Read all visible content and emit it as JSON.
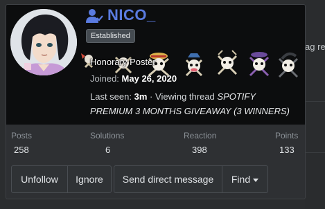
{
  "background": {
    "partial_text": "ag re"
  },
  "profile": {
    "username": "NICO_",
    "badge": "Established",
    "title": "Honorary Poster",
    "joined_label": "Joined:",
    "joined_date": "May 26, 2020",
    "last_seen_label": "Last seen:",
    "last_seen_time": "3m",
    "activity": "Viewing thread",
    "thread_title": "SPOTIFY PREMIUM 3 MONTHS GIVEAWAY (3 WINNERS)"
  },
  "stats": {
    "posts_label": "Posts",
    "posts": "258",
    "solutions_label": "Solutions",
    "solutions": "6",
    "reaction_label": "Reaction",
    "reaction": "398",
    "points_label": "Points",
    "points": "133"
  },
  "actions": {
    "unfollow": "Unfollow",
    "ignore": "Ignore",
    "send_dm": "Send direct message",
    "find": "Find"
  },
  "colors": {
    "username": "#5a7be0",
    "header_bg": "#0c0d0e",
    "card_bg": "#2e3033"
  }
}
